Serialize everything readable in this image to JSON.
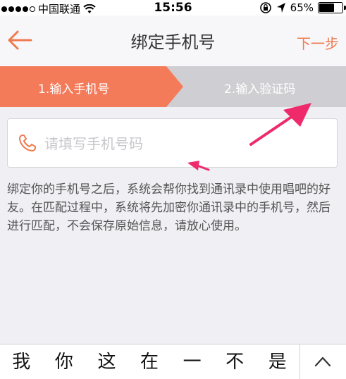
{
  "status_bar": {
    "carrier": "中国联通",
    "time": "15:56",
    "battery": "65%",
    "battery_level": 0.65
  },
  "nav": {
    "title": "绑定手机号",
    "next_label": "下一步"
  },
  "steps": [
    {
      "label": "1.输入手机号",
      "active": true
    },
    {
      "label": "2.输入验证码",
      "active": false
    }
  ],
  "phone": {
    "placeholder": "请填写手机号码",
    "value": ""
  },
  "description": "绑定你的手机号之后，系统会帮你找到通讯录中使用唱吧的好友。在匹配过程中，系统将先加密你通讯录中的手机号，然后进行匹配，不会保存原始信息，请放心使用。",
  "keyboard": {
    "suggestions": [
      "我",
      "你",
      "这",
      "在",
      "一",
      "不",
      "是"
    ]
  },
  "colors": {
    "accent": "#f07a50",
    "step_active": "#f47b5a",
    "step_inactive": "#cfcfd3",
    "arrow": "#ee2a6b"
  }
}
